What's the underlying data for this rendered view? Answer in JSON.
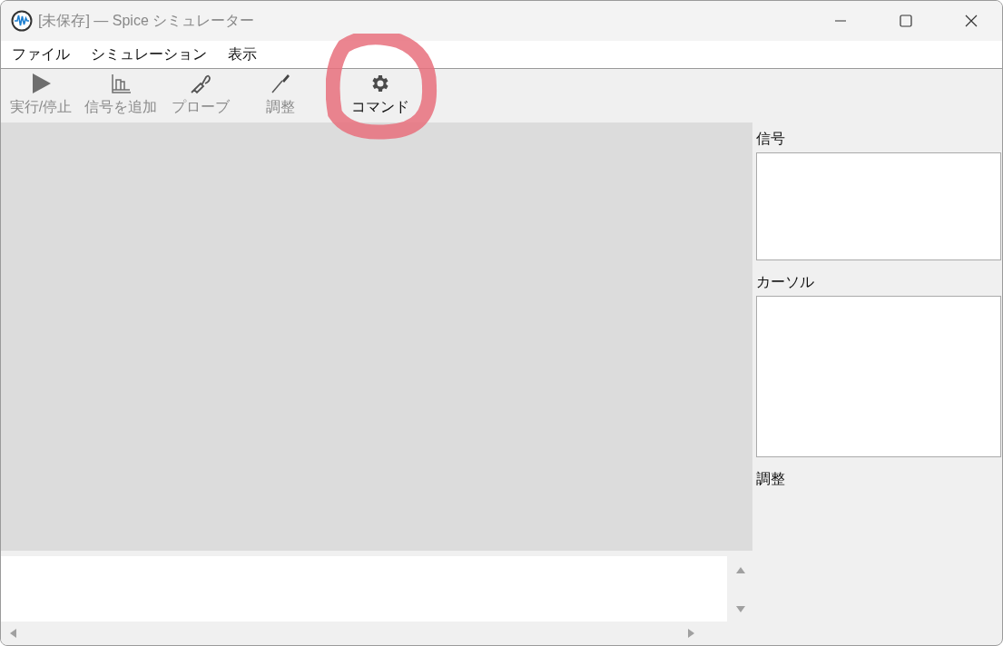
{
  "window": {
    "title": "[未保存] — Spice シミュレーター"
  },
  "menu": [
    {
      "label": "ファイル"
    },
    {
      "label": "シミュレーション"
    },
    {
      "label": "表示"
    }
  ],
  "toolbar": [
    {
      "kind": "run",
      "label": "実行/停止",
      "disabled": true
    },
    {
      "kind": "signal",
      "label": "信号を追加",
      "disabled": true
    },
    {
      "kind": "probe",
      "label": "プローブ",
      "disabled": true
    },
    {
      "kind": "tune",
      "label": "調整",
      "disabled": true
    },
    {
      "kind": "command",
      "label": "コマンド",
      "disabled": false
    }
  ],
  "side_panel": {
    "signals_label": "信号",
    "cursors_label": "カーソル",
    "tune_label": "調整"
  }
}
